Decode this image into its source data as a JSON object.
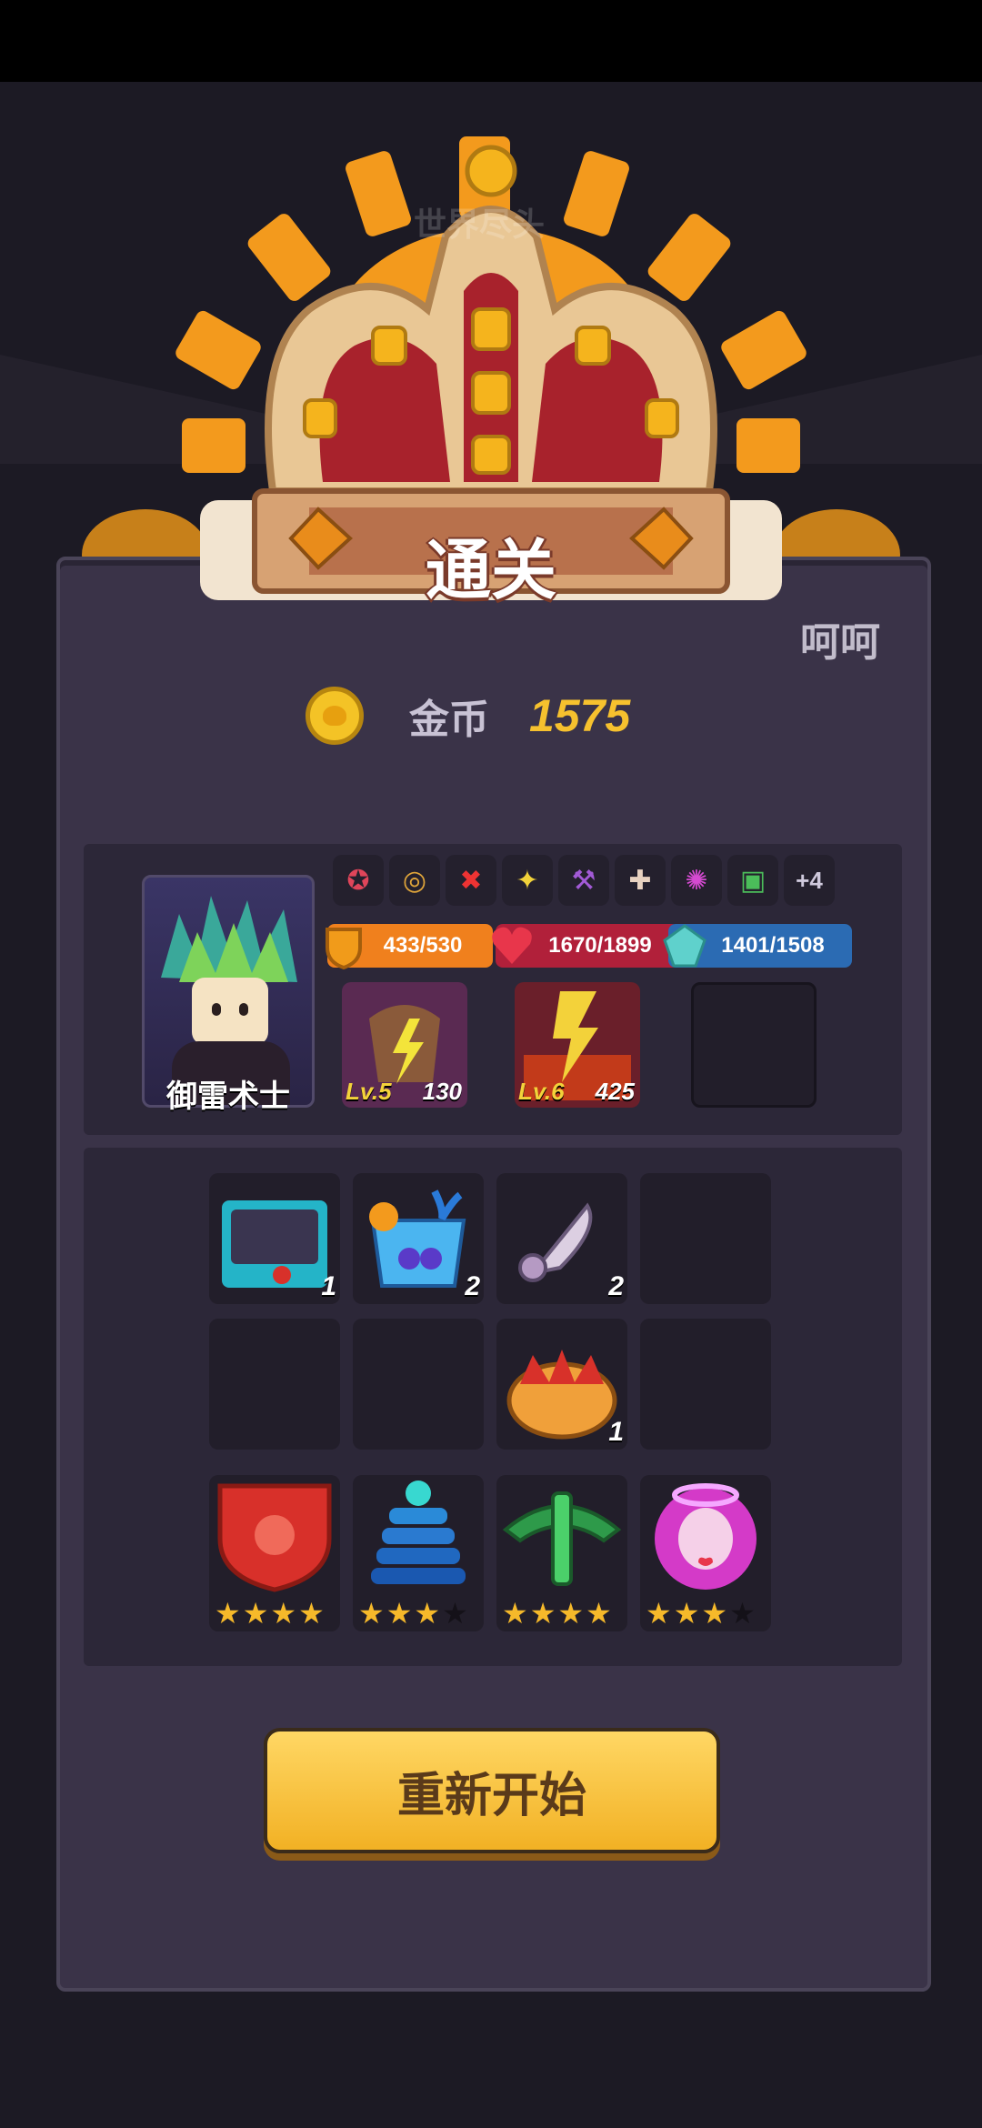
{
  "watermark_top": "世界尽头",
  "watermark_right": "呵呵",
  "title": "通关",
  "coins": {
    "label": "金币",
    "value": "1575"
  },
  "hero": {
    "name": "御雷术士",
    "buffs_more": "+4",
    "stats": {
      "armor": "433/530",
      "hp": "1670/1899",
      "mana": "1401/1508"
    },
    "skills": [
      {
        "level": "Lv.5",
        "points": "130"
      },
      {
        "level": "Lv.6",
        "points": "425"
      }
    ]
  },
  "items": [
    {
      "name": "cat-cart-item",
      "count": "1"
    },
    {
      "name": "cocktail-item",
      "count": "2"
    },
    {
      "name": "knife-item",
      "count": "2"
    },
    {
      "name": "crown-bread-item",
      "count": "1"
    }
  ],
  "relics": [
    {
      "name": "red-shield-relic",
      "stars": 4
    },
    {
      "name": "blue-tower-relic",
      "stars": 3
    },
    {
      "name": "green-crossbow-relic",
      "stars": 4
    },
    {
      "name": "angel-girl-relic",
      "stars": 3
    }
  ],
  "restart_label": "重新开始",
  "colors": {
    "gold": "#f6c12e",
    "panel": "#3a3348",
    "button": "#f2b124"
  }
}
